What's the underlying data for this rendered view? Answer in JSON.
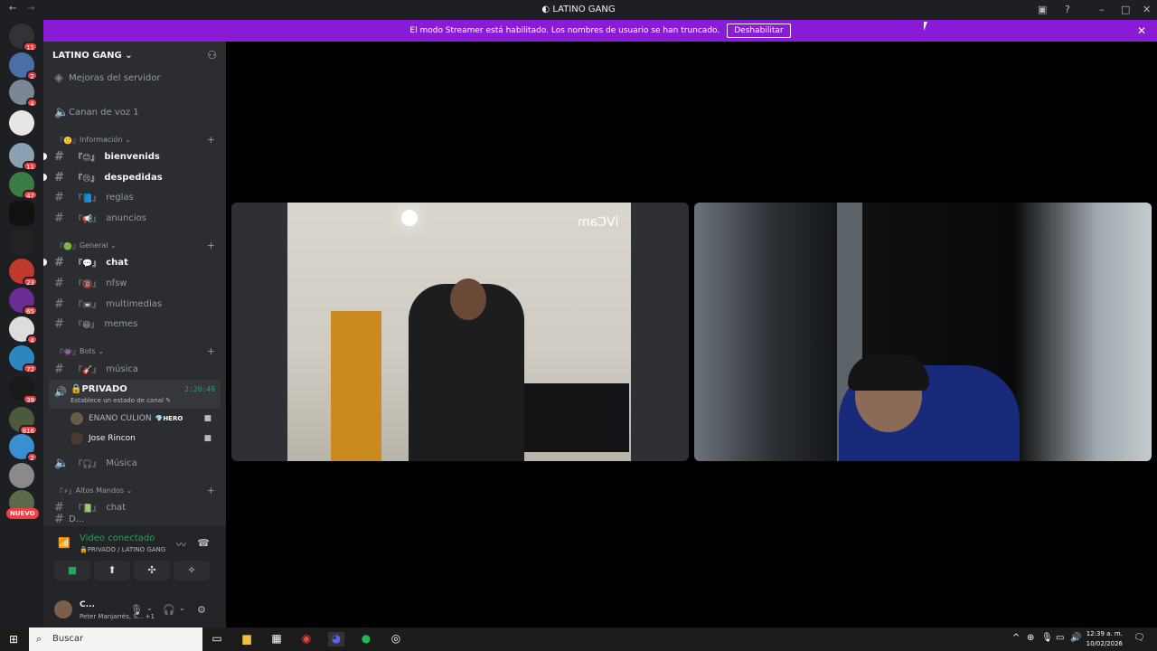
{
  "window": {
    "title": "LATINO GANG",
    "back_icon": "arrow-left",
    "forward_icon": "arrow-right"
  },
  "banner": {
    "message": "El modo Streamer está habilitado. Los nombres de usuario se han truncado.",
    "button": "Deshabilitar",
    "close": "✕"
  },
  "servers": [
    {
      "badge": "11"
    },
    {
      "badge": "2"
    },
    {
      "badge": "4"
    },
    {
      "badge": ""
    },
    {
      "badge": "11"
    },
    {
      "badge": "47"
    },
    {
      "badge": ""
    },
    {
      "badge": ""
    },
    {
      "badge": "23"
    },
    {
      "badge": "65"
    },
    {
      "badge": "4"
    },
    {
      "badge": "72"
    },
    {
      "badge": "39"
    },
    {
      "badge": "816"
    },
    {
      "badge": "2"
    },
    {
      "badge": ""
    },
    {
      "badge": ""
    }
  ],
  "nuevo": "NUEVO",
  "guild": {
    "name": "LATINO GANG ⌄"
  },
  "channels": {
    "boost": "Mejoras del servidor",
    "voice1": "Canan de voz 1",
    "cat_info": "Información ⌄",
    "bienvenids": "bienvenids",
    "despedidas": "despedidas",
    "reglas": "reglas",
    "anuncios": "anuncios",
    "cat_general": "General ⌄",
    "chat": "chat",
    "nfsw": "nfsw",
    "multimedias": "multimedias",
    "memes": "memes",
    "cat_bots": "Bots ⌄",
    "musica": "música",
    "privado": "PRIVADO",
    "privado_status": "Establece un estado de canal ✎",
    "privado_time": "2:20:49",
    "user1": "ENANO CULION",
    "user1_tag": "HERO",
    "user2": "Jose Rincon",
    "musica_voice": "Música",
    "cat_altos": "Altos Mandos ⌄",
    "chat2": "chat",
    "partial": "D..."
  },
  "rtc": {
    "status": "Video conectado",
    "channel": "🔒PRIVADO / LATINO GANG"
  },
  "user_panel": {
    "name": "C...",
    "status": "Peter Manjarrés, S... +1"
  },
  "video1": {
    "overlay": "iVCam"
  },
  "taskbar": {
    "search": "Buscar",
    "time": "12:39 a. m.",
    "date": "10/02/2026"
  }
}
